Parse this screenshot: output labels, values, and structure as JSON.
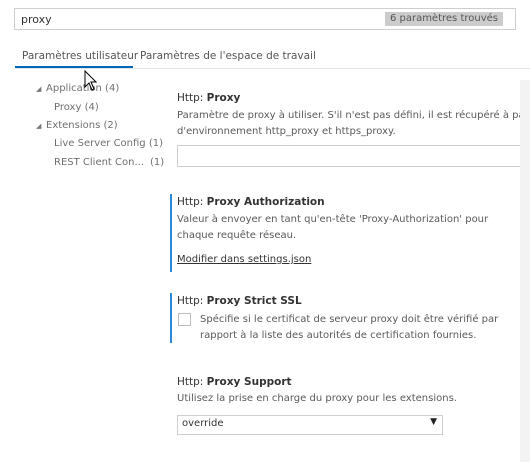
{
  "search": {
    "value": "proxy",
    "results_count": "6 paramètres trouvés"
  },
  "tabs": [
    {
      "label": "Paramètres utilisateur",
      "active": true
    },
    {
      "label": "Paramètres de l'espace de travail",
      "active": false
    }
  ],
  "tree": [
    {
      "label": "Application (4)",
      "expanded": true
    },
    {
      "label": "Proxy (4)"
    },
    {
      "label": "Extensions (2)",
      "expanded": true
    },
    {
      "label": "Live Server Config (1)"
    },
    {
      "label": "REST Client Con...",
      "count": "(1)"
    }
  ],
  "settings": {
    "proxy": {
      "category": "Http: ",
      "name": "Proxy",
      "description_line1": "Paramètre de proxy à utiliser. S'il n'est pas défini, il est récupéré à partir de",
      "description_line2": "d'environnement http_proxy et https_proxy.",
      "value": ""
    },
    "proxy_authorization": {
      "category": "Http: ",
      "name": "Proxy Authorization",
      "description_line1": "Valeur à envoyer en tant qu'en-tête 'Proxy-Authorization' pour",
      "description_line2": "chaque requête réseau.",
      "link": "Modifier dans settings.json"
    },
    "proxy_strict_ssl": {
      "category": "Http: ",
      "name": "Proxy Strict SSL",
      "description_line1": "Spécifie si le certificat de serveur proxy doit être vérifié par",
      "description_line2": "rapport à la liste des autorités de certification fournies.",
      "checked": false
    },
    "proxy_support": {
      "category": "Http: ",
      "name": "Proxy Support",
      "description": "Utilisez la prise en charge du proxy pour les extensions.",
      "value": "override"
    }
  },
  "colors": {
    "accent": "#0066b8",
    "modified_bar": "#2b88d8",
    "badge_bg": "#cccccc"
  },
  "icons": {
    "expand": "chevron-down-icon",
    "dropdown": "dropdown-arrow-icon",
    "cursor": "mouse-pointer-icon"
  }
}
